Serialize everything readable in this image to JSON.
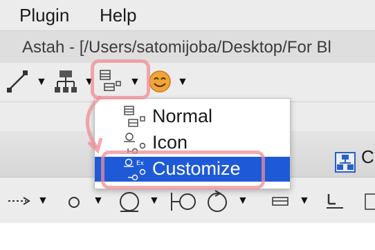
{
  "menubar": {
    "items": [
      "Plugin",
      "Help"
    ]
  },
  "window": {
    "title": "Astah - [/Users/satomijoba/Desktop/For Bl"
  },
  "toolbar": {
    "buttons": [
      {
        "icon": "line-style-icon"
      },
      {
        "icon": "tree-layout-icon"
      },
      {
        "icon": "class-display-mode-icon"
      },
      {
        "icon": "smiley-face-icon"
      }
    ]
  },
  "dropdown": {
    "items": [
      {
        "label": "Normal",
        "icon": "class-box-icon",
        "selected": false
      },
      {
        "label": "Icon",
        "icon": "class-icon-symbol-icon",
        "selected": false
      },
      {
        "label": "Customize",
        "icon": "custom-class-icon",
        "selected": true
      }
    ]
  },
  "tab": {
    "label": "C",
    "icon": "diagram-icon"
  },
  "colors": {
    "selection": "#1e5ad8",
    "highlight": "#f08c96",
    "toolbar_bg": "#ececec"
  }
}
